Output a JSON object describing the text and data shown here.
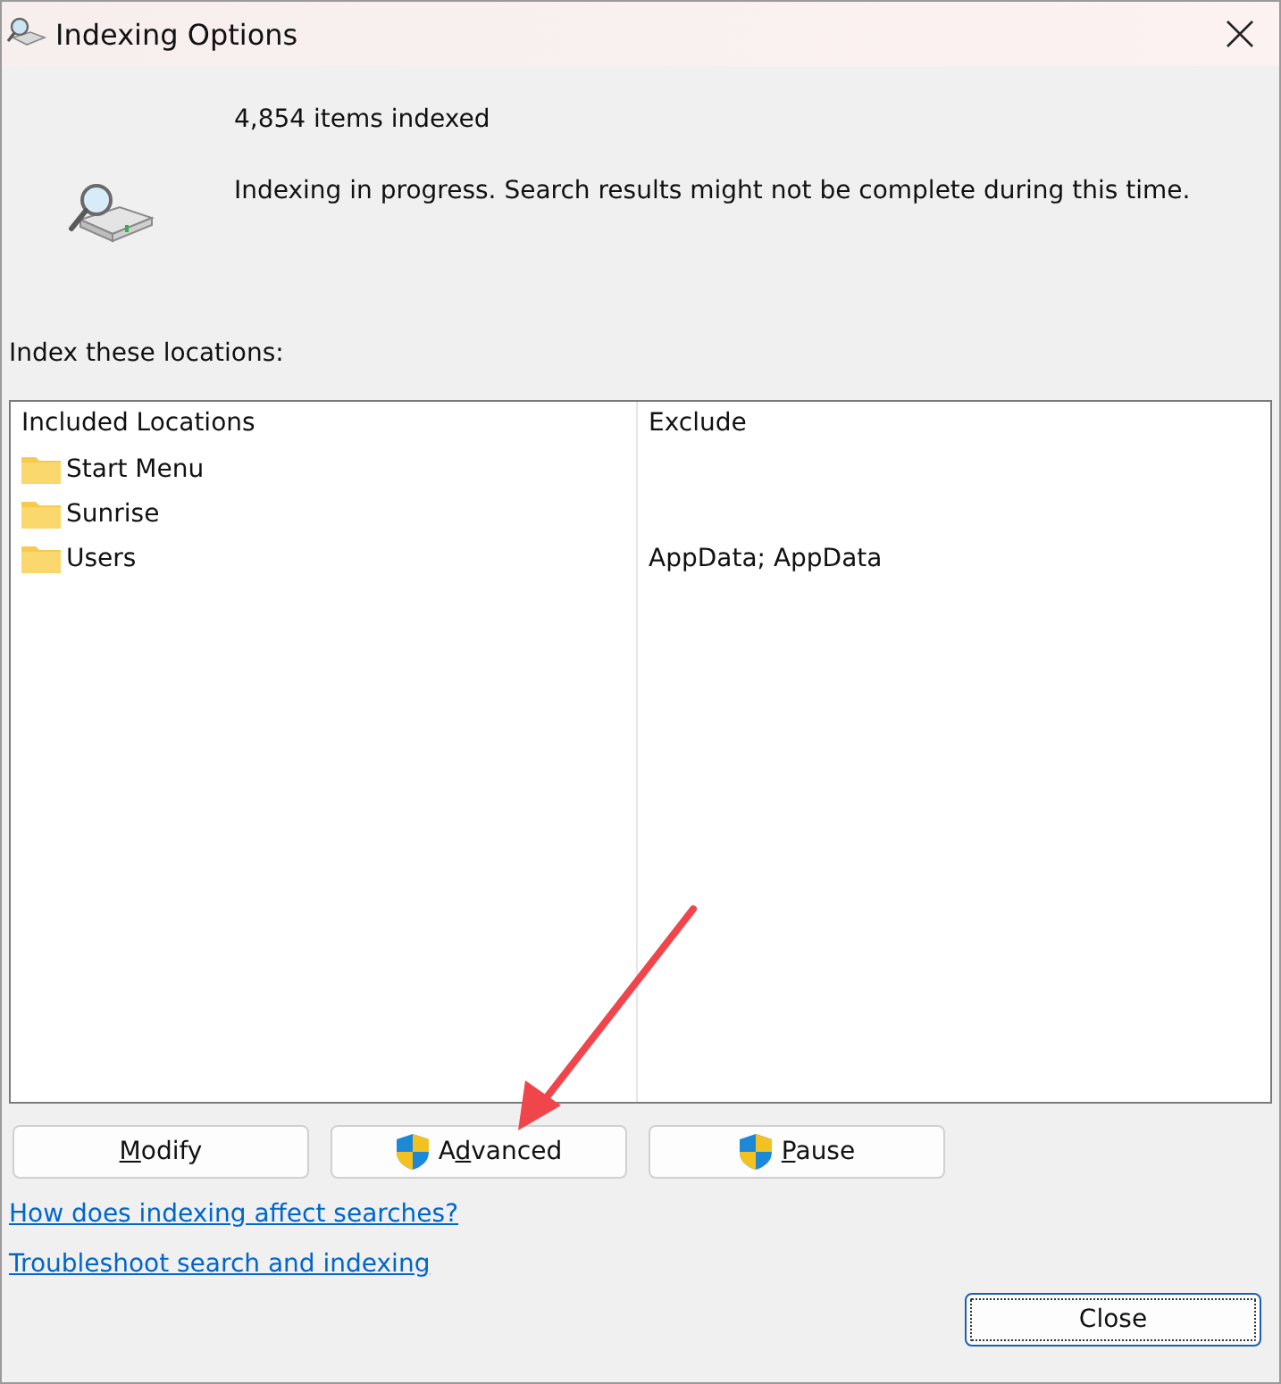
{
  "window": {
    "title": "Indexing Options"
  },
  "status": {
    "count": "4,854 items indexed",
    "message": "Indexing in progress. Search results might not be complete during this time."
  },
  "locations_label": "Index these locations:",
  "table": {
    "columns": [
      "Included Locations",
      "Exclude"
    ],
    "rows": [
      {
        "location": "Start Menu"
      },
      {
        "location": "Sunrise"
      },
      {
        "location": "Users",
        "exclude": "AppData; AppData"
      }
    ]
  },
  "buttons": [
    {
      "key": "M",
      "after": "odify",
      "shield": false
    },
    {
      "before": "A",
      "key": "d",
      "after": "vanced",
      "shield": true
    },
    {
      "key": "P",
      "after": "ause",
      "shield": true
    }
  ],
  "links": [
    "How does indexing affect searches?",
    "Troubleshoot search and indexing"
  ],
  "close_button": "Close"
}
